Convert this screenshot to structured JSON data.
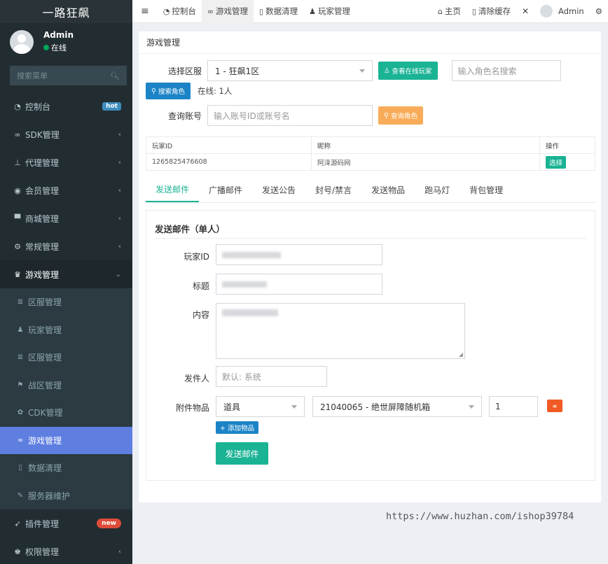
{
  "brand": "一路狂飙",
  "user": {
    "name": "Admin",
    "status": "在线"
  },
  "sidebar": {
    "search_placeholder": "搜索菜单",
    "items": [
      {
        "label": "控制台",
        "icon": "dashboard-icon",
        "badge": "hot"
      },
      {
        "label": "SDK管理",
        "icon": "link-icon"
      },
      {
        "label": "代理管理",
        "icon": "sitemap-icon"
      },
      {
        "label": "会员管理",
        "icon": "user-circle-icon"
      },
      {
        "label": "商城管理",
        "icon": "cart-icon"
      },
      {
        "label": "常规管理",
        "icon": "cogs-icon"
      },
      {
        "label": "游戏管理",
        "icon": "trophy-icon"
      }
    ],
    "subitems": [
      {
        "label": "区服管理",
        "icon": "list-icon"
      },
      {
        "label": "玩家管理",
        "icon": "user-icon"
      },
      {
        "label": "区服管理",
        "icon": "list-icon"
      },
      {
        "label": "战区管理",
        "icon": "flag-icon"
      },
      {
        "label": "CDK管理",
        "icon": "gift-icon"
      },
      {
        "label": "游戏管理",
        "icon": "gamepad-icon"
      },
      {
        "label": "数据清理",
        "icon": "trash-icon"
      },
      {
        "label": "服务器维护",
        "icon": "wrench-icon"
      }
    ],
    "bottom_items": [
      {
        "label": "插件管理",
        "icon": "rocket-icon",
        "badge": "new"
      },
      {
        "label": "权限管理",
        "icon": "users-icon"
      }
    ]
  },
  "topnav": {
    "items": [
      "控制台",
      "游戏管理",
      "数据清理",
      "玩家管理"
    ],
    "right": [
      "主页",
      "清除缓存",
      "Admin"
    ]
  },
  "page": {
    "title": "游戏管理",
    "server_label": "选择区服",
    "server_value": "1 - 狂飙1区",
    "view_online_btn": "查看在线玩家",
    "role_search_placeholder": "输入角色名搜索",
    "search_role_btn": "搜索角色",
    "online_text": "在线: 1人",
    "account_label": "查询账号",
    "account_placeholder": "输入账号ID或账号名",
    "query_role_btn": "查询角色",
    "table": {
      "headers": [
        "玩家ID",
        "昵称",
        "操作"
      ],
      "rows": [
        {
          "id": "1265825476608",
          "nickname": "阿泽源码网",
          "action": "选择"
        }
      ]
    },
    "tabs": [
      "发送邮件",
      "广播邮件",
      "发送公告",
      "封号/禁言",
      "发送物品",
      "跑马灯",
      "背包管理"
    ],
    "mail": {
      "title": "发送邮件（单人）",
      "player_id_label": "玩家ID",
      "subject_label": "标题",
      "content_label": "内容",
      "sender_label": "发件人",
      "sender_placeholder": "默认: 系统",
      "attach_label": "附件物品",
      "attach_type": "道具",
      "attach_item": "21040065 - 绝世屏障随机箱",
      "attach_qty": "1",
      "add_item_btn": "+ 添加物品",
      "send_btn": "发送邮件"
    }
  },
  "watermark": "https://www.huzhan.com/ishop39784",
  "colors": {
    "sidebar_bg": "#222d32",
    "accent_green": "#1ab394",
    "accent_blue": "#1c84c6",
    "active_menu": "#5e7ee0"
  }
}
